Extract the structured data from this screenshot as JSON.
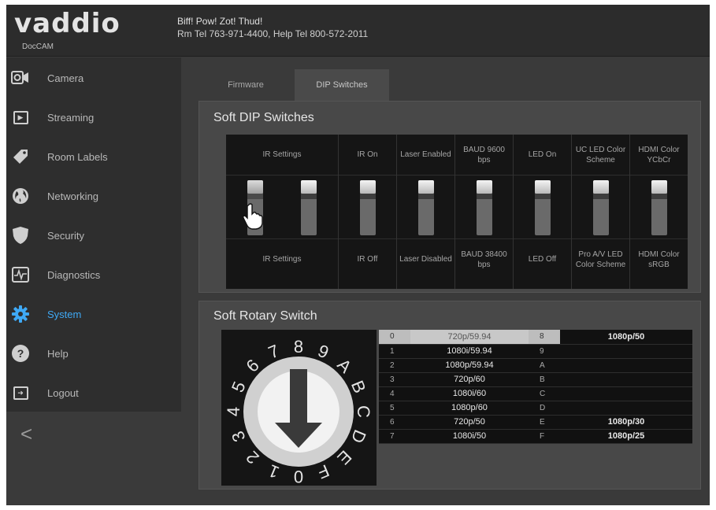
{
  "header": {
    "logo": "vaddio",
    "product": "DocCAM",
    "line1": "Biff! Pow! Zot! Thud!",
    "line2": "Rm Tel 763-971-4400, Help Tel 800-572-2011"
  },
  "sidebar": {
    "items": [
      {
        "label": "Camera",
        "icon": "camera-icon"
      },
      {
        "label": "Streaming",
        "icon": "play-icon"
      },
      {
        "label": "Room Labels",
        "icon": "tag-icon"
      },
      {
        "label": "Networking",
        "icon": "globe-icon"
      },
      {
        "label": "Security",
        "icon": "shield-icon"
      },
      {
        "label": "Diagnostics",
        "icon": "pulse-icon"
      },
      {
        "label": "System",
        "icon": "gear-icon",
        "active": true
      },
      {
        "label": "Help",
        "icon": "help-icon"
      },
      {
        "label": "Logout",
        "icon": "logout-icon"
      }
    ],
    "collapse": "<",
    "help_glyph": "?"
  },
  "tabs": [
    {
      "label": "Firmware"
    },
    {
      "label": "DIP Switches",
      "active": true
    }
  ],
  "dip": {
    "title": "Soft DIP Switches",
    "columns": [
      {
        "top": "IR Settings",
        "bottom": "IR Settings",
        "switches": [
          "off",
          "on"
        ]
      },
      {
        "top": "IR On",
        "bottom": "IR Off",
        "switches": [
          "on"
        ]
      },
      {
        "top": "Laser Enabled",
        "bottom": "Laser Disabled",
        "switches": [
          "on"
        ]
      },
      {
        "top": "BAUD 9600 bps",
        "bottom": "BAUD 38400 bps",
        "switches": [
          "on"
        ]
      },
      {
        "top": "LED On",
        "bottom": "LED Off",
        "switches": [
          "on"
        ]
      },
      {
        "top": "UC LED Color Scheme",
        "bottom": "Pro A/V LED Color Scheme",
        "switches": [
          "on"
        ]
      },
      {
        "top": "HDMI Color YCbCr",
        "bottom": "HDMI Color sRGB",
        "switches": [
          "on"
        ]
      }
    ]
  },
  "rotary": {
    "title": "Soft Rotary Switch",
    "dial_labels": [
      "0",
      "1",
      "2",
      "3",
      "4",
      "5",
      "6",
      "7",
      "8",
      "9",
      "A",
      "B",
      "C",
      "D",
      "E",
      "F"
    ],
    "selected": "0",
    "rows": [
      {
        "k1": "0",
        "v1": "720p/59.94",
        "k2": "8",
        "v2": "1080p/50"
      },
      {
        "k1": "1",
        "v1": "1080i/59.94",
        "k2": "9",
        "v2": ""
      },
      {
        "k1": "2",
        "v1": "1080p/59.94",
        "k2": "A",
        "v2": ""
      },
      {
        "k1": "3",
        "v1": "720p/60",
        "k2": "B",
        "v2": ""
      },
      {
        "k1": "4",
        "v1": "1080i/60",
        "k2": "C",
        "v2": ""
      },
      {
        "k1": "5",
        "v1": "1080p/60",
        "k2": "D",
        "v2": ""
      },
      {
        "k1": "6",
        "v1": "720p/50",
        "k2": "E",
        "v2": "1080p/30"
      },
      {
        "k1": "7",
        "v1": "1080i/50",
        "k2": "F",
        "v2": "1080p/25"
      }
    ]
  },
  "colors": {
    "accent": "#3fa9f5",
    "panel": "#484848",
    "background": "#3a3a3a"
  }
}
